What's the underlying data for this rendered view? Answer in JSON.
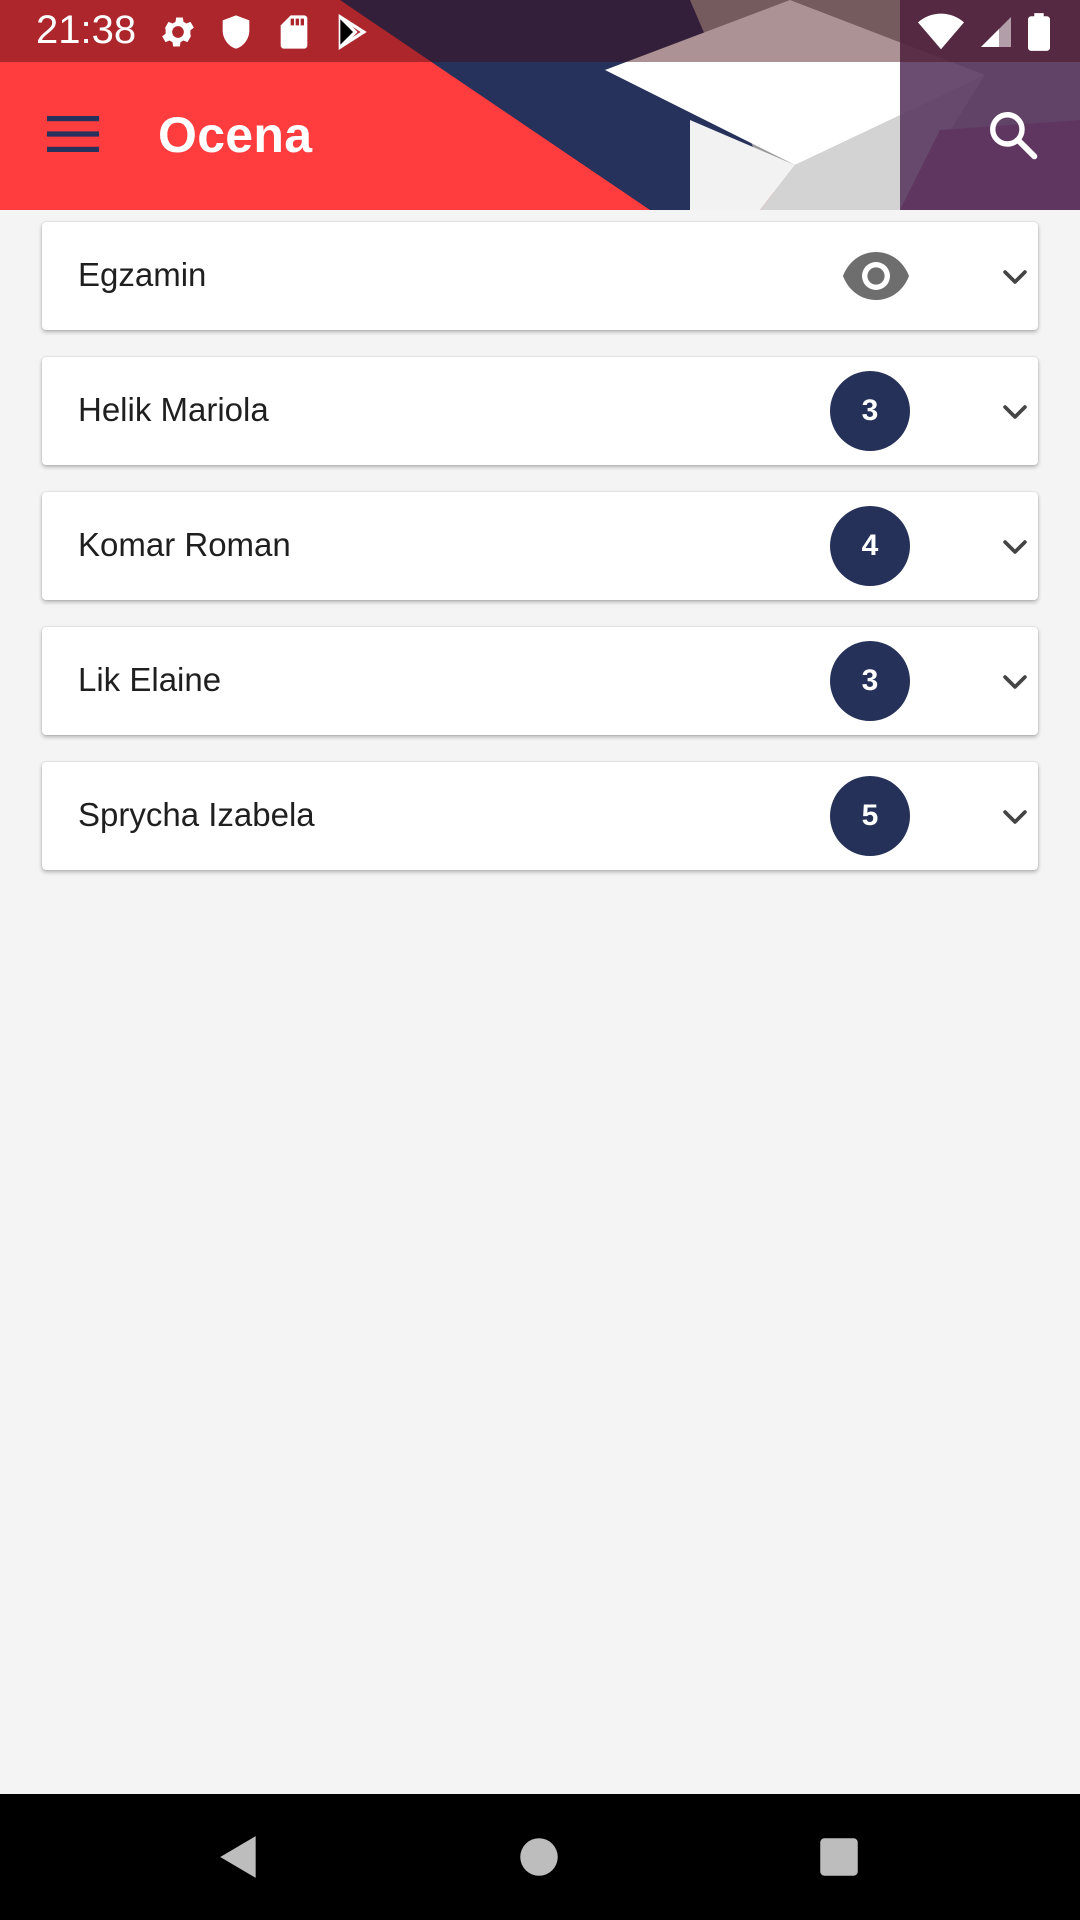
{
  "status_bar": {
    "time": "21:38"
  },
  "toolbar": {
    "title": "Ocena"
  },
  "list": [
    {
      "label": "Egzamin",
      "type": "eye"
    },
    {
      "label": "Helik Mariola",
      "grade": "3"
    },
    {
      "label": "Komar Roman",
      "grade": "4"
    },
    {
      "label": "Lik Elaine",
      "grade": "3"
    },
    {
      "label": "Sprycha Izabela",
      "grade": "5"
    }
  ],
  "colors": {
    "header_red": "#ff3c3e",
    "badge_navy": "#263159",
    "background": "#f4f4f4"
  },
  "icons": [
    "menu-icon",
    "search-icon",
    "eye-icon",
    "chevron-down-icon",
    "back-icon",
    "home-icon",
    "recent-apps-icon"
  ]
}
